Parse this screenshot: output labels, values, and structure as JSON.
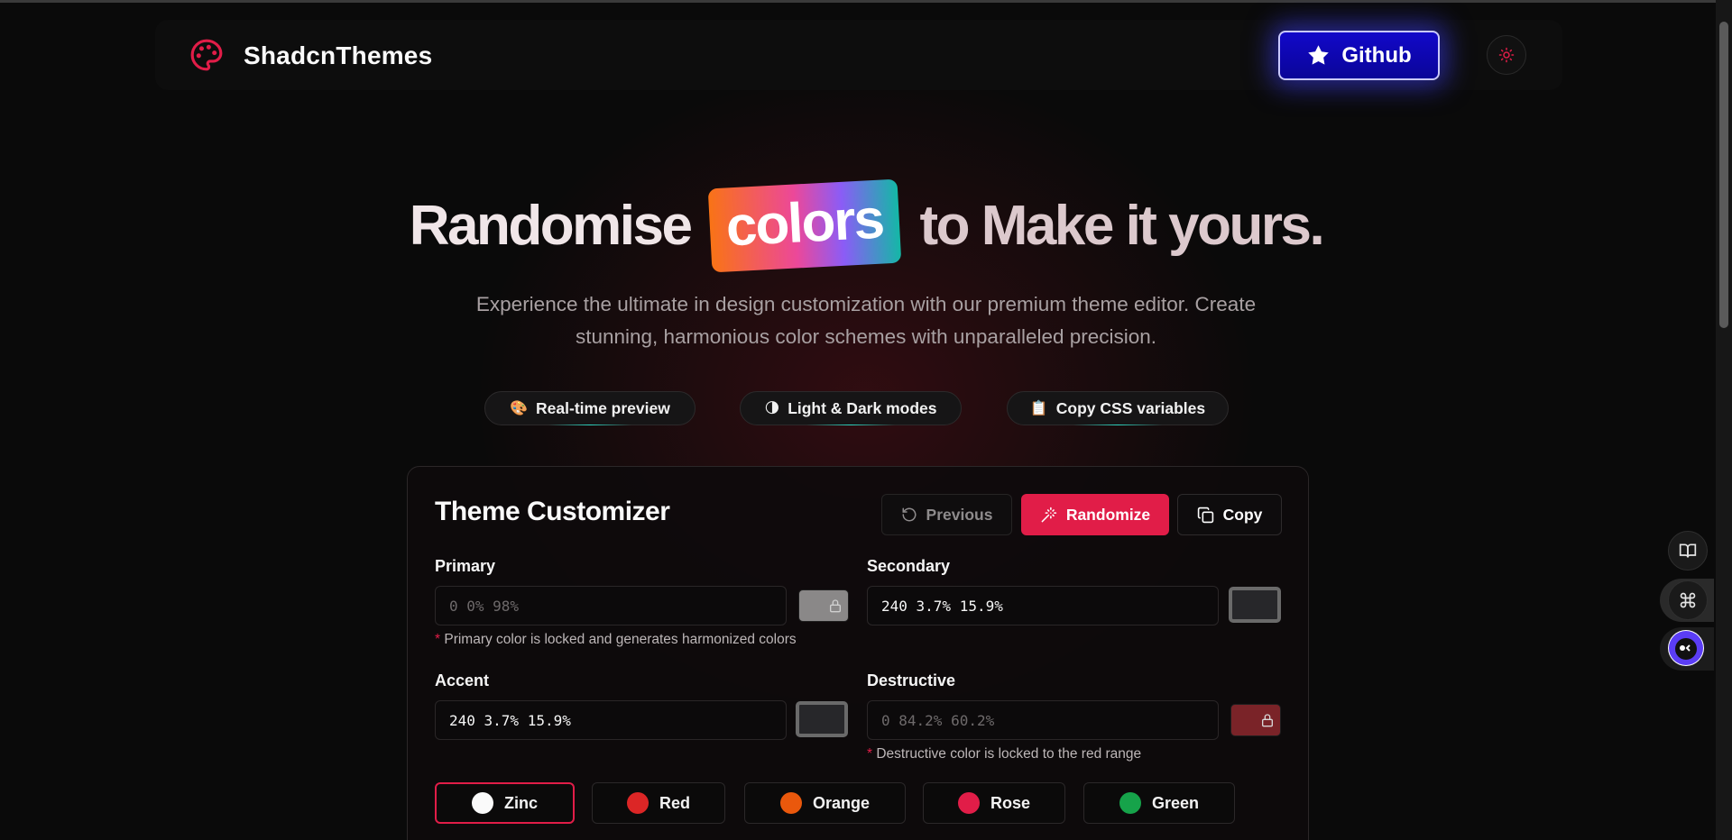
{
  "nav": {
    "brand": "ShadcnThemes",
    "github_label": "Github"
  },
  "hero": {
    "word_randomise": "Randomise",
    "word_colors": "colors",
    "rest": "to Make it yours.",
    "subtitle_line1": "Experience the ultimate in design customization with our premium theme editor. Create",
    "subtitle_line2": "stunning, harmonious color schemes with unparalleled precision."
  },
  "features": [
    {
      "emoji": "🎨",
      "label": "Real-time preview"
    },
    {
      "emoji": "🌗",
      "label": "Light & Dark modes"
    },
    {
      "emoji": "📋",
      "label": "Copy CSS variables"
    }
  ],
  "customizer": {
    "title": "Theme Customizer",
    "previous_label": "Previous",
    "randomize_label": "Randomize",
    "copy_label": "Copy",
    "primary": {
      "label": "Primary",
      "value": "0 0% 98%",
      "swatch_color": "#8a8888",
      "note_asterisk": "*",
      "note": "Primary color is locked and generates harmonized colors"
    },
    "secondary": {
      "label": "Secondary",
      "value": "240 3.7% 15.9%",
      "swatch_color": "#27272a"
    },
    "accent": {
      "label": "Accent",
      "value": "240 3.7% 15.9%",
      "swatch_color": "#27272a"
    },
    "destructive": {
      "label": "Destructive",
      "value": "0 84.2% 60.2%",
      "swatch_color": "#7a2328",
      "note_asterisk": "*",
      "note": "Destructive color is locked to the red range"
    },
    "presets": [
      {
        "label": "Zinc",
        "color": "#fafafa",
        "active": true
      },
      {
        "label": "Red",
        "color": "#dc2626",
        "active": false
      },
      {
        "label": "Orange",
        "color": "#ea580c",
        "active": false
      },
      {
        "label": "Rose",
        "color": "#e11d48",
        "active": false
      },
      {
        "label": "Green",
        "color": "#16a34a",
        "active": false
      }
    ]
  },
  "colors": {
    "accent": "#e11d48",
    "github_bg": "#0a0598",
    "background": "#0a0a0a"
  }
}
